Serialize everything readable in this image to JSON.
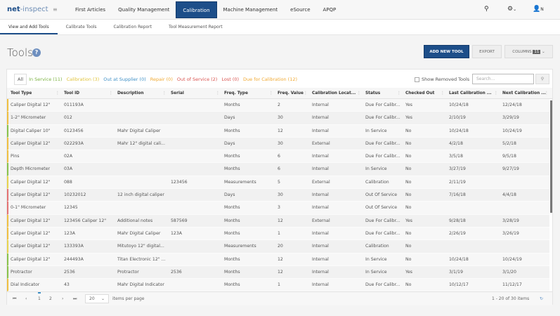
{
  "header": {
    "logo_main": "net",
    "logo_rest": "-inspect",
    "nav": [
      "First Articles",
      "Quality Management",
      "Calibration",
      "Machine Management",
      "eSource",
      "APQP"
    ],
    "active_nav": "Calibration",
    "user_label": "N"
  },
  "subtabs": [
    "View and Add Tools",
    "Calibrate Tools",
    "Calibration Report",
    "Tool Measurement Report"
  ],
  "page": {
    "title": "Tools",
    "add_button": "ADD NEW TOOL",
    "export_button": "EXPORT",
    "columns_button": "COLUMNS",
    "columns_count": "11"
  },
  "filters": [
    {
      "label": "All",
      "color": "#555555"
    },
    {
      "label": "In Service (11)",
      "color": "#7cb342"
    },
    {
      "label": "Calibration (3)",
      "color": "#e0c33a"
    },
    {
      "label": "Out at Supplier (0)",
      "color": "#3d8fc6"
    },
    {
      "label": "Repair (0)",
      "color": "#f0a830"
    },
    {
      "label": "Out of Service (2)",
      "color": "#d9534f"
    },
    {
      "label": "Lost (0)",
      "color": "#d9534f"
    },
    {
      "label": "Due for Calibration (12)",
      "color": "#f0a830"
    }
  ],
  "show_removed": "Show Removed Tools",
  "search": {
    "placeholder": "Search..."
  },
  "columns": [
    "Tool Type",
    "Tool ID",
    "Description",
    "Serial",
    "Freq. Type",
    "Freq. Value",
    "Calibration Locat...",
    "Status",
    "Checked Out",
    "Last Calibration ...",
    "Next Calibration ..."
  ],
  "rows": [
    [
      "Caliper Digital 12\"",
      "011193A",
      "",
      "",
      "Months",
      "2",
      "Internal",
      "Due For Calibr...",
      "Yes",
      "10/24/18",
      "12/24/18"
    ],
    [
      "1-2\" Micrometer",
      "012",
      "",
      "",
      "Days",
      "30",
      "Internal",
      "Due For Calibr...",
      "Yes",
      "2/10/19",
      "3/29/19"
    ],
    [
      "Digital Caliper 10\"",
      "0123456",
      "Mahr Digital Caliper",
      "",
      "Months",
      "12",
      "Internal",
      "In Service",
      "No",
      "10/24/18",
      "10/24/19"
    ],
    [
      "Caliper Digital 12\"",
      "022293A",
      "Mahr 12\" digital cali...",
      "",
      "Days",
      "30",
      "External",
      "Due For Calibr...",
      "No",
      "4/2/18",
      "5/2/18"
    ],
    [
      "Pins",
      "02A",
      "",
      "",
      "Months",
      "6",
      "Internal",
      "Due For Calibr...",
      "No",
      "3/5/18",
      "9/5/18"
    ],
    [
      "Depth Micrometer",
      "03A",
      "",
      "",
      "Months",
      "6",
      "Internal",
      "In Service",
      "No",
      "3/27/19",
      "9/27/19"
    ],
    [
      "Caliper Digital 12\"",
      "088",
      "",
      "123456",
      "Measurements",
      "5",
      "External",
      "Calibration",
      "No",
      "2/11/19",
      ""
    ],
    [
      "Caliper Digital 12\"",
      "10232012",
      "12 inch digital caliper",
      "",
      "Days",
      "30",
      "Internal",
      "Out Of Service",
      "No",
      "7/16/18",
      "4/4/18"
    ],
    [
      "0-1\" Micrometer",
      "12345",
      "",
      "",
      "Months",
      "3",
      "Internal",
      "Out Of Service",
      "No",
      "",
      ""
    ],
    [
      "Caliper Digital 12\"",
      "123456 Caliper 12\"",
      "Additional notes",
      "587569",
      "Months",
      "12",
      "External",
      "Due For Calibr...",
      "Yes",
      "9/28/18",
      "3/28/19"
    ],
    [
      "Caliper Digital 12\"",
      "123A",
      "Mahr Digital Caliper",
      "123A",
      "Months",
      "1",
      "Internal",
      "Due For Calibr...",
      "No",
      "2/26/19",
      "3/26/19"
    ],
    [
      "Caliper Digital 12\"",
      "133393A",
      "Mitutoyo 12\" digital...",
      "",
      "Measurements",
      "20",
      "Internal",
      "Calibration",
      "No",
      "",
      ""
    ],
    [
      "Caliper Digital 12\"",
      "244493A",
      "Titan Electronic 12\" ...",
      "",
      "Months",
      "12",
      "Internal",
      "In Service",
      "No",
      "10/24/18",
      "10/24/19"
    ],
    [
      "Protractor",
      "2536",
      "Protractor",
      "2536",
      "Months",
      "12",
      "Internal",
      "In Service",
      "Yes",
      "3/1/19",
      "3/1/20"
    ],
    [
      "Dial Indicator",
      "43",
      "Mahr Digital Indicator",
      "",
      "Months",
      "1",
      "Internal",
      "Due For Calibr...",
      "No",
      "10/12/17",
      "11/12/17"
    ]
  ],
  "status_colors": {
    "Due For Calibr...": "#f0c040",
    "In Service": "#8bc34a",
    "Calibration": "#e8d44d",
    "Out Of Service": "#e57373"
  },
  "pager": {
    "pages": [
      "1",
      "2"
    ],
    "current": "1",
    "page_size": "20",
    "items_per_page": "items per page",
    "summary": "1 - 20 of 30 items"
  }
}
